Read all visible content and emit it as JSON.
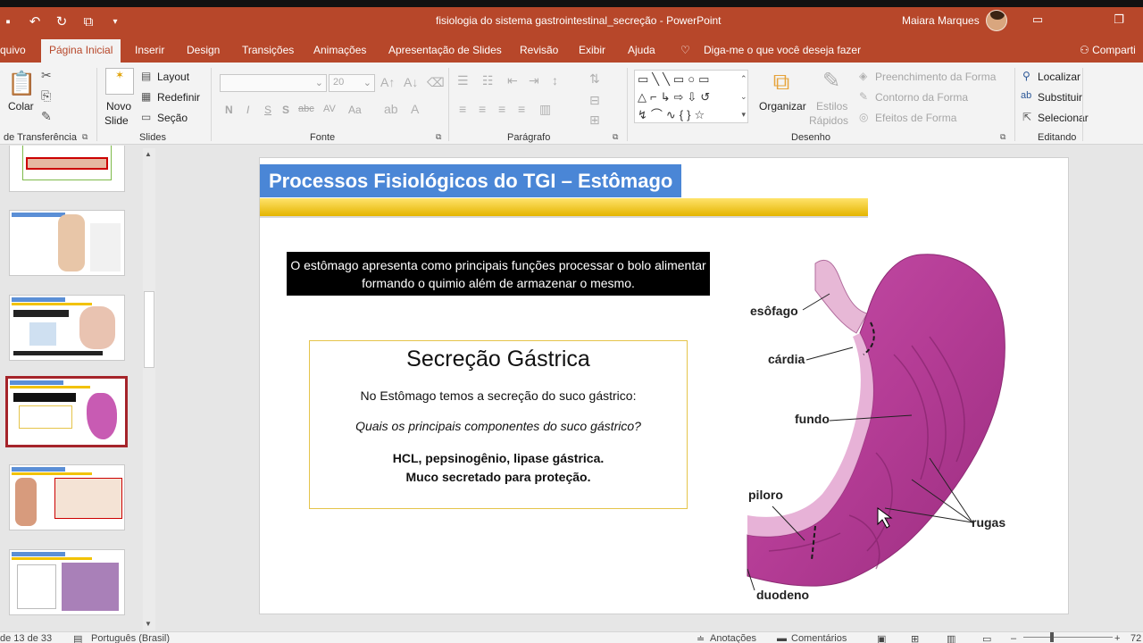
{
  "window": {
    "title": "fisiologia do sistema gastrointestinal_secreção  -  PowerPoint",
    "user": "Maiara Marques"
  },
  "tabs": [
    {
      "label": "quivo"
    },
    {
      "label": "Página Inicial"
    },
    {
      "label": "Inserir"
    },
    {
      "label": "Design"
    },
    {
      "label": "Transições"
    },
    {
      "label": "Animações"
    },
    {
      "label": "Apresentação de Slides"
    },
    {
      "label": "Revisão"
    },
    {
      "label": "Exibir"
    },
    {
      "label": "Ajuda"
    }
  ],
  "tell_me": "Diga-me o que você deseja fazer",
  "share": "Comparti",
  "ribbon": {
    "clipboard": {
      "paste": "Colar",
      "label": "de Transferência"
    },
    "slides": {
      "new_slide_1": "Novo",
      "new_slide_2": "Slide",
      "layout": "Layout",
      "reset": "Redefinir",
      "section": "Seção",
      "label": "Slides"
    },
    "font": {
      "size": "20",
      "label": "Fonte",
      "bold": "N",
      "italic": "I",
      "underline": "S",
      "shadow": "S",
      "strike": "abc",
      "spacing": "AV",
      "case": "Aa"
    },
    "paragraph": {
      "label": "Parágrafo"
    },
    "drawing": {
      "arrange": "Organizar",
      "styles_1": "Estilos",
      "styles_2": "Rápidos",
      "fill": "Preenchimento da Forma",
      "outline": "Contorno da Forma",
      "effects": "Efeitos de Forma",
      "label": "Desenho"
    },
    "editing": {
      "find": "Localizar",
      "replace": "Substituir",
      "select": "Selecionar",
      "label": "Editando"
    }
  },
  "slide": {
    "title": "Processos Fisiológicos do TGI – Estômago",
    "intro": "O estômago apresenta como principais funções processar o bolo alimentar formando o quimio além de armazenar o mesmo.",
    "box_heading": "Secreção Gástrica",
    "box_line1": "No Estômago temos a secreção do suco gástrico:",
    "box_question": "Quais os principais componentes do suco gástrico?",
    "box_answer1": "HCL, pepsinogênio, lipase gástrica.",
    "box_answer2": "Muco secretado para proteção.",
    "labels": {
      "esofago": "esôfago",
      "cardia": "cárdia",
      "fundo": "fundo",
      "piloro": "piloro",
      "rugas": "rugas",
      "duodeno": "duodeno"
    }
  },
  "status": {
    "slide_count": "de 13 de 33",
    "language": "Português (Brasil)",
    "notes": "Anotações",
    "comments": "Comentários",
    "zoom": "72"
  },
  "colors": {
    "accent": "#b7472a",
    "title_bar_blue": "#4a86d6",
    "title_underline": "#f2c200"
  }
}
